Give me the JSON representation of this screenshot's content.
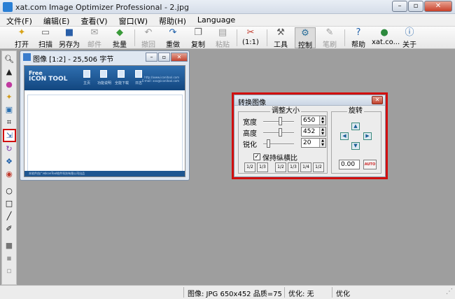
{
  "window": {
    "title": "xat.com  Image Optimizer Professional - 2.jpg"
  },
  "menu": [
    "文件(F)",
    "编辑(E)",
    "查看(V)",
    "窗口(W)",
    "帮助(H)",
    "Language"
  ],
  "toolbar": {
    "open": "打开",
    "scan": "扫描",
    "save_as": "另存为",
    "mail": "邮件",
    "batch": "批量",
    "undo": "撤回",
    "redo": "重做",
    "copy": "复制",
    "paste": "粘贴",
    "zoom": "(1:1)",
    "tools": "工具",
    "control": "控制",
    "pen": "笔刷",
    "help": "帮助",
    "site": "xat.co...",
    "about": "关于"
  },
  "image_window": {
    "title": "图像 [1:2] - 25,506 字节",
    "banner": {
      "logo_line1": "Free",
      "logo_line2": "ICON TOOL",
      "captions": [
        "主页",
        "功能说明",
        "全能下载",
        "日志"
      ],
      "right_line1": "http://www.iconitool.com",
      "right_line2": "E-mail: xxx@iconitool.com"
    },
    "footer": "本软件由广州IconTool软件科技有限公司出品"
  },
  "dialog": {
    "title": "转换图像",
    "resize_legend": "调整大小",
    "rotate_legend": "旋转",
    "width_label": "宽度",
    "height_label": "高度",
    "sharpen_label": "锐化",
    "width": "650",
    "height": "452",
    "sharpen": "20",
    "keep_ratio": "保持纵横比",
    "ratio_buttons": [
      "1/2",
      "1/3",
      "1/2",
      "1/3",
      "1/4",
      "1/2"
    ],
    "angle": "0.00",
    "auto_label": "AUTO"
  },
  "status": {
    "info": "图像: JPG 650x452  品质=75",
    "optimize": "优化: 无",
    "extra": "优化"
  }
}
